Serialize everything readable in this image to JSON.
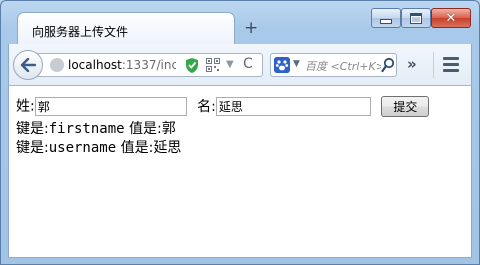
{
  "tab": {
    "title": "向服务器上传文件",
    "new_tab_glyph": "+"
  },
  "window_controls": {
    "close_glyph": "✕"
  },
  "toolbar": {
    "url_host": "localhost",
    "url_rest": ":1337/inc",
    "search_placeholder": "百度 <Ctrl+K>",
    "overflow_glyph": "»",
    "reload_glyph": "C"
  },
  "form": {
    "firstname_label": "姓:",
    "firstname_value": "郭",
    "username_label": "名:",
    "username_value": "延思",
    "submit_label": "提交"
  },
  "results": [
    {
      "key_prefix": "键是:",
      "key": "firstname",
      "value_prefix": " 值是:",
      "value": "郭"
    },
    {
      "key_prefix": "键是:",
      "key": "username",
      "value_prefix": " 值是:",
      "value": "延思"
    }
  ]
}
